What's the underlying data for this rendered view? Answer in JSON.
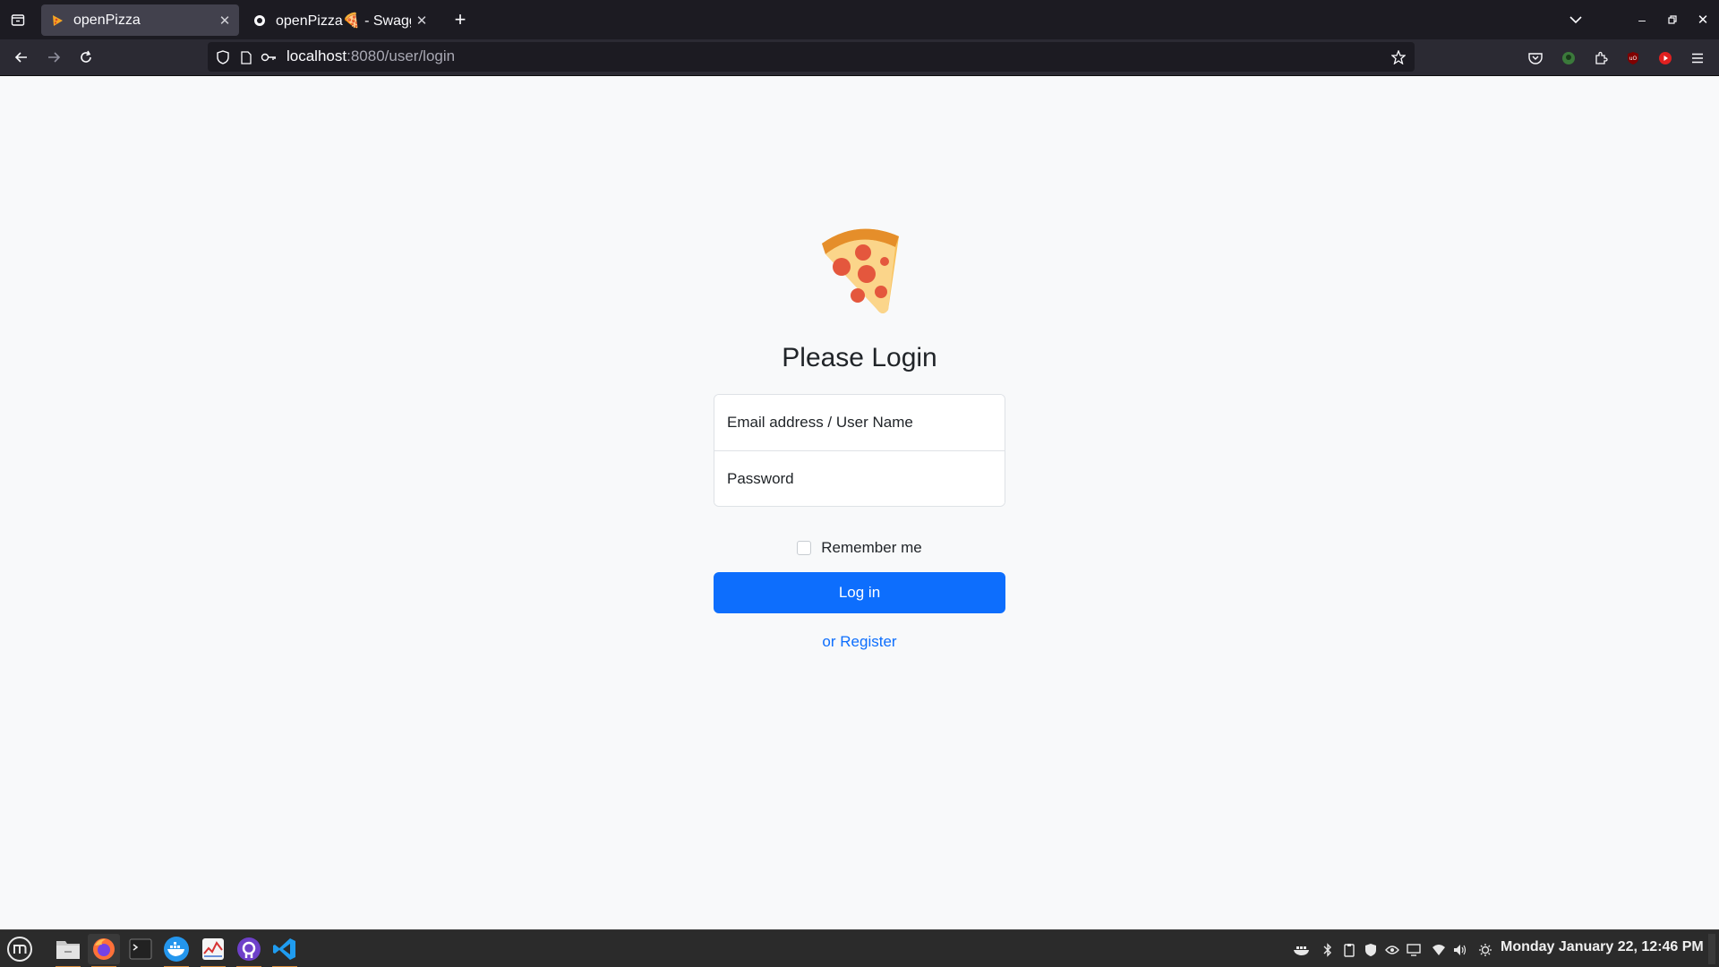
{
  "browser": {
    "tabs": [
      {
        "title": "openPizza",
        "active": true
      },
      {
        "title": "openPizza🍕 - Swagger",
        "active": false
      }
    ],
    "url_host": "localhost",
    "url_path": ":8080/user/login"
  },
  "login": {
    "heading": "Please Login",
    "username_placeholder": "Email address / User Name",
    "password_placeholder": "Password",
    "remember_label": "Remember me",
    "login_button": "Log in",
    "register_link": "or Register"
  },
  "taskbar": {
    "clock": "Monday January 22, 12:46 PM"
  },
  "colors": {
    "primary": "#0d6efd",
    "page_bg": "#f8f9fa",
    "chrome_dark": "#1c1b22",
    "chrome_toolbar": "#2b2a33"
  }
}
